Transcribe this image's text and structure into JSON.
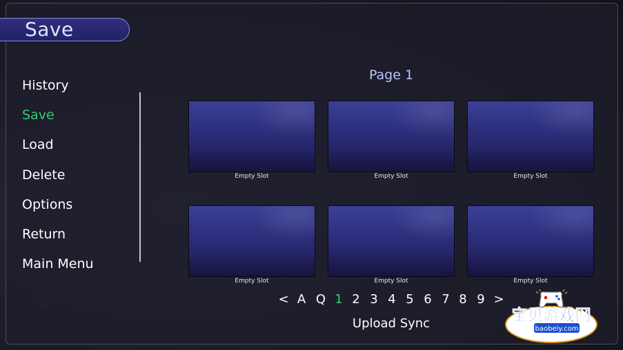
{
  "screen": {
    "title": "Save"
  },
  "nav": {
    "items": [
      {
        "label": "History",
        "active": false
      },
      {
        "label": "Save",
        "active": true
      },
      {
        "label": "Load",
        "active": false
      },
      {
        "label": "Delete",
        "active": false
      },
      {
        "label": "Options",
        "active": false
      },
      {
        "label": "Return",
        "active": false
      },
      {
        "label": "Main Menu",
        "active": false
      }
    ]
  },
  "slots": {
    "page_label": "Page 1",
    "items": [
      {
        "label": "Empty Slot"
      },
      {
        "label": "Empty Slot"
      },
      {
        "label": "Empty Slot"
      },
      {
        "label": "Empty Slot"
      },
      {
        "label": "Empty Slot"
      },
      {
        "label": "Empty Slot"
      }
    ]
  },
  "pagination": {
    "items": [
      {
        "label": "<",
        "active": false
      },
      {
        "label": "A",
        "active": false
      },
      {
        "label": "Q",
        "active": false
      },
      {
        "label": "1",
        "active": true
      },
      {
        "label": "2",
        "active": false
      },
      {
        "label": "3",
        "active": false
      },
      {
        "label": "4",
        "active": false
      },
      {
        "label": "5",
        "active": false
      },
      {
        "label": "6",
        "active": false
      },
      {
        "label": "7",
        "active": false
      },
      {
        "label": "8",
        "active": false
      },
      {
        "label": "9",
        "active": false
      },
      {
        "label": ">",
        "active": false
      }
    ],
    "upload_sync_label": "Upload Sync"
  },
  "watermark": {
    "text": "宝贝游戏网",
    "url_text": "baobeiy.com",
    "icon": "gamepad-icon"
  },
  "colors": {
    "accent_active": "#2fd06b",
    "page_label": "#b8c4ff",
    "banner": "#2f2f80",
    "watermark_red": "#e02020",
    "watermark_blue": "#1a4fd0"
  }
}
